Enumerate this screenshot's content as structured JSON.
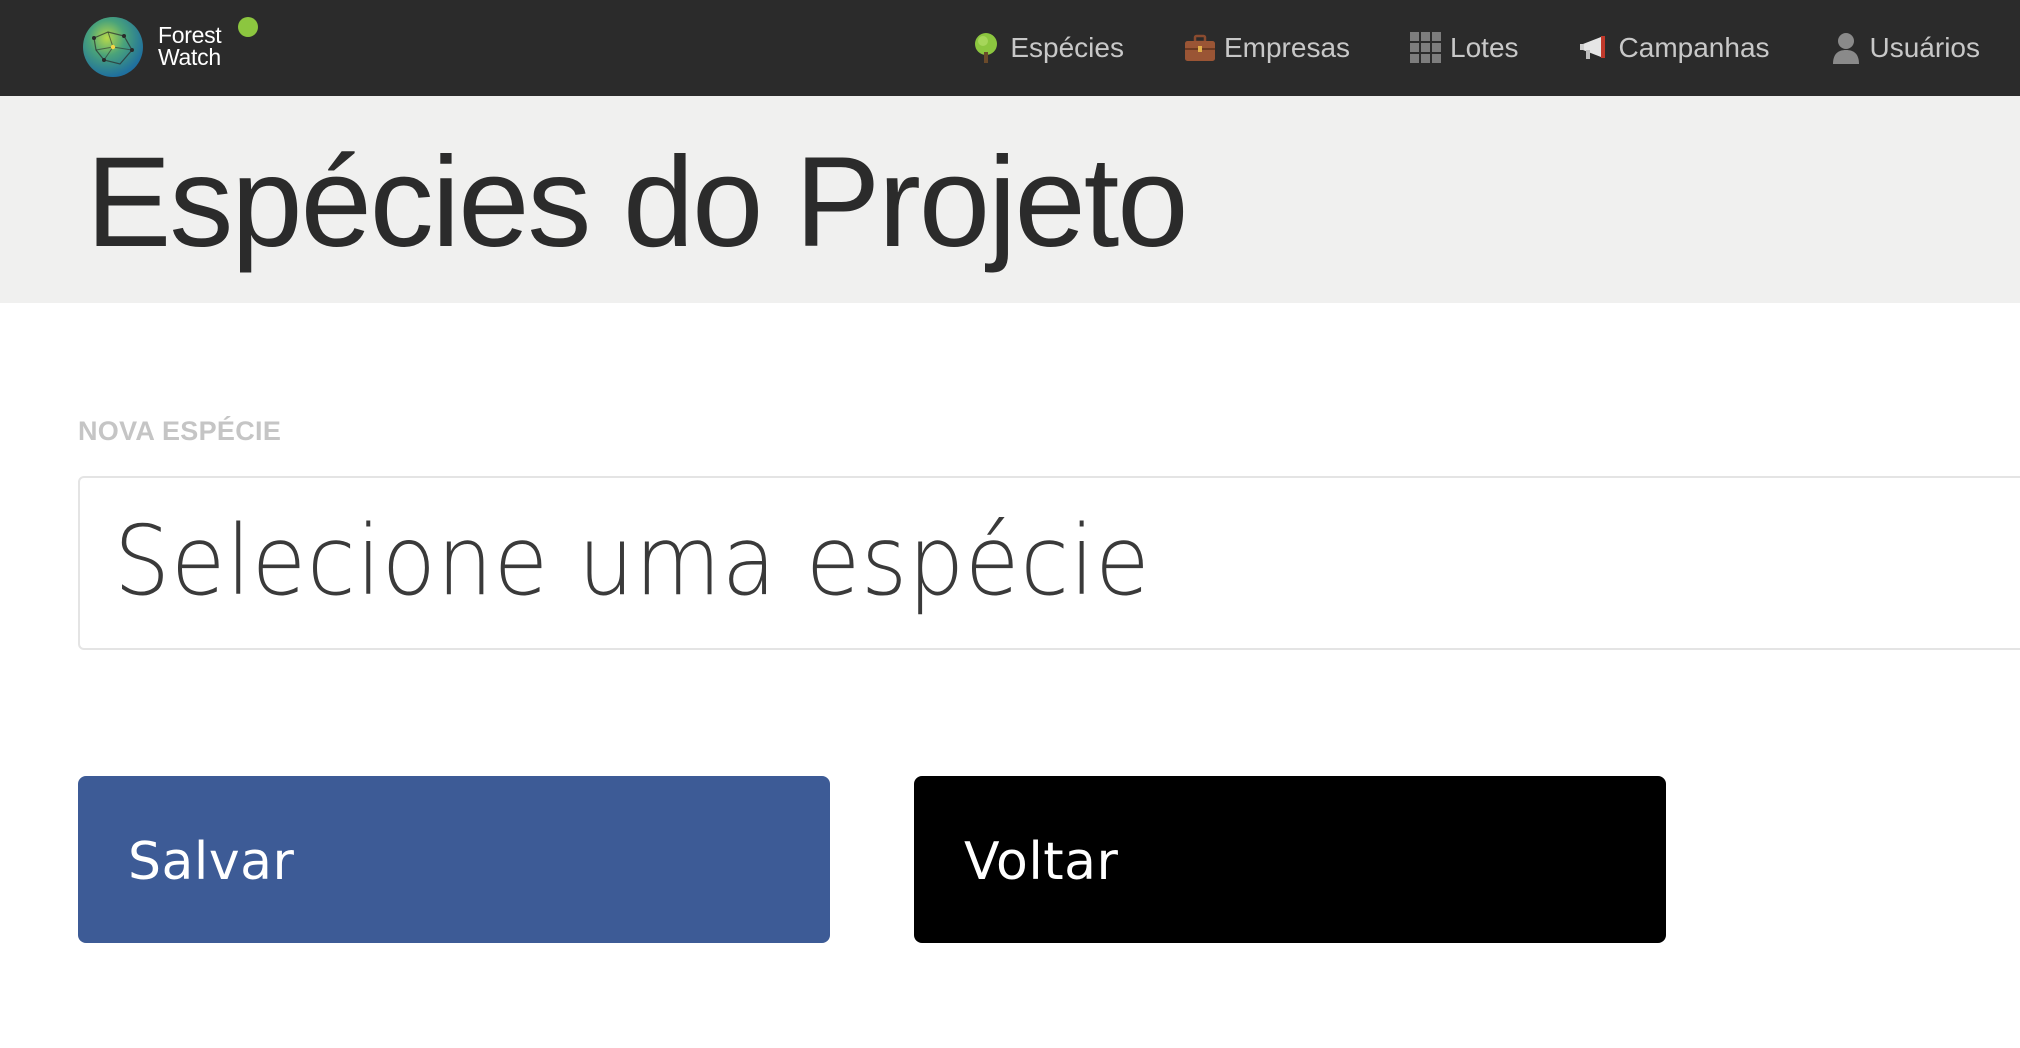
{
  "brand": {
    "line1": "Forest",
    "line2": "Watch",
    "status_color": "#8cc63f"
  },
  "nav": {
    "items": [
      {
        "label": "Espécies",
        "icon": "tree-icon"
      },
      {
        "label": "Empresas",
        "icon": "briefcase-icon"
      },
      {
        "label": "Lotes",
        "icon": "grid-icon"
      },
      {
        "label": "Campanhas",
        "icon": "megaphone-icon"
      },
      {
        "label": "Usuários",
        "icon": "user-icon"
      }
    ]
  },
  "page": {
    "title": "Espécies do Projeto"
  },
  "form": {
    "species_label": "NOVA ESPÉCIE",
    "species_placeholder": "Selecione uma espécie",
    "save_label": "Salvar",
    "back_label": "Voltar"
  },
  "colors": {
    "navbar": "#2b2b2b",
    "header_band": "#f0f0ef",
    "save_button": "#3d5b96",
    "back_button": "#000000"
  }
}
